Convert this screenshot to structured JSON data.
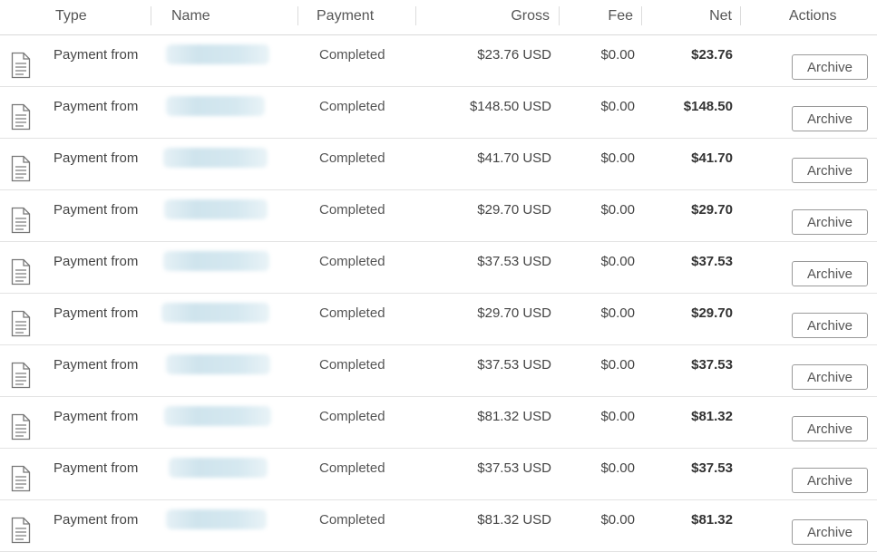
{
  "header": {
    "type": "Type",
    "name": "Name",
    "payment": "Payment",
    "gross": "Gross",
    "fee": "Fee",
    "net": "Net",
    "actions": "Actions"
  },
  "rows": [
    {
      "type": "Payment from",
      "name_icon": "redacted-name",
      "payment": "Completed",
      "gross": "$23.76 USD",
      "fee": "$0.00",
      "net": "$23.76",
      "action": "Archive"
    },
    {
      "type": "Payment from",
      "name_icon": "redacted-name",
      "payment": "Completed",
      "gross": "$148.50 USD",
      "fee": "$0.00",
      "net": "$148.50",
      "action": "Archive"
    },
    {
      "type": "Payment from",
      "name_icon": "redacted-name",
      "payment": "Completed",
      "gross": "$41.70 USD",
      "fee": "$0.00",
      "net": "$41.70",
      "action": "Archive"
    },
    {
      "type": "Payment from",
      "name_icon": "redacted-name",
      "payment": "Completed",
      "gross": "$29.70 USD",
      "fee": "$0.00",
      "net": "$29.70",
      "action": "Archive"
    },
    {
      "type": "Payment from",
      "name_icon": "redacted-name",
      "payment": "Completed",
      "gross": "$37.53 USD",
      "fee": "$0.00",
      "net": "$37.53",
      "action": "Archive"
    },
    {
      "type": "Payment from",
      "name_icon": "redacted-name",
      "payment": "Completed",
      "gross": "$29.70 USD",
      "fee": "$0.00",
      "net": "$29.70",
      "action": "Archive"
    },
    {
      "type": "Payment from",
      "name_icon": "redacted-name",
      "payment": "Completed",
      "gross": "$37.53 USD",
      "fee": "$0.00",
      "net": "$37.53",
      "action": "Archive"
    },
    {
      "type": "Payment from",
      "name_icon": "redacted-name",
      "payment": "Completed",
      "gross": "$81.32 USD",
      "fee": "$0.00",
      "net": "$81.32",
      "action": "Archive"
    },
    {
      "type": "Payment from",
      "name_icon": "redacted-name",
      "payment": "Completed",
      "gross": "$37.53 USD",
      "fee": "$0.00",
      "net": "$37.53",
      "action": "Archive"
    },
    {
      "type": "Payment from",
      "name_icon": "redacted-name",
      "payment": "Completed",
      "gross": "$81.32 USD",
      "fee": "$0.00",
      "net": "$81.32",
      "action": "Archive"
    }
  ],
  "icons": {
    "row_type": "document-icon"
  }
}
